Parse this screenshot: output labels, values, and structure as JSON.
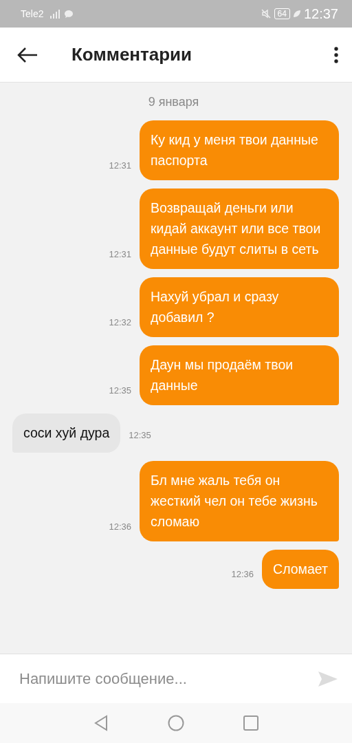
{
  "status_bar": {
    "carrier": "Tele2",
    "battery": "64",
    "time": "12:37"
  },
  "header": {
    "title": "Комментарии"
  },
  "date_separator": "9 января",
  "messages": [
    {
      "text": "Ку кид у меня твои данные паспорта",
      "time": "12:31",
      "outgoing": true
    },
    {
      "text": "Возвращай деньги или кидай аккаунт или все твои данные будут слиты в сеть",
      "time": "12:31",
      "outgoing": true
    },
    {
      "text": "Нахуй убрал и сразу добавил ?",
      "time": "12:32",
      "outgoing": true
    },
    {
      "text": "Даун мы продаём твои данные",
      "time": "12:35",
      "outgoing": true
    },
    {
      "text": "соси хуй дура",
      "time": "12:35",
      "outgoing": false
    },
    {
      "text": "Бл мне жаль тебя он жесткий чел он тебе жизнь сломаю",
      "time": "12:36",
      "outgoing": true
    },
    {
      "text": "Сломает",
      "time": "12:36",
      "outgoing": true
    }
  ],
  "composer": {
    "placeholder": "Напишите сообщение..."
  }
}
